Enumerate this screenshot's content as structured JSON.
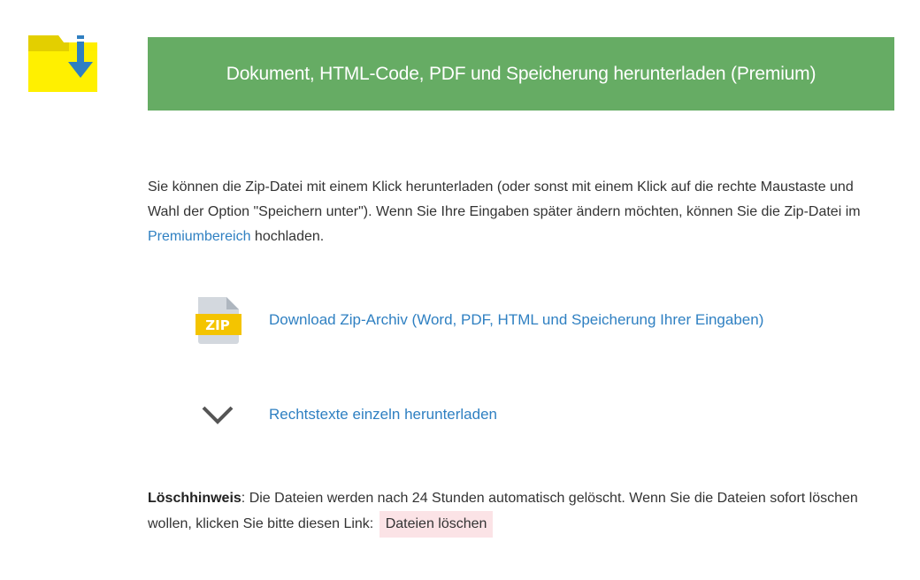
{
  "colors": {
    "banner_bg": "#66ac64",
    "link": "#2f80c2",
    "folder": "#ffee00",
    "download_arrow": "#2f7fc1",
    "delete_button_bg": "#fbe3e6"
  },
  "banner": {
    "title": "Dokument, HTML-Code, PDF und Speicherung herunterladen (Premium)"
  },
  "intro": {
    "text_before_link": "Sie können die Zip-Datei mit einem Klick herunterladen (oder sonst mit einem Klick auf die rechte Maustaste und Wahl der Option \"Speichern unter\"). Wenn Sie Ihre Eingaben später ändern möchten, können Sie die Zip-Datei im ",
    "link_label": "Premiumbereich",
    "text_after_link": " hochladen."
  },
  "downloads": {
    "zip_icon_label": "ZIP",
    "zip_link_label": "Download Zip-Archiv (Word, PDF, HTML und Speicherung Ihrer Eingaben)",
    "single_texts_label": "Rechtstexte einzeln herunterladen"
  },
  "notice": {
    "title": "Löschhinweis",
    "text": ": Die Dateien werden nach 24 Stunden automatisch gelöscht. Wenn Sie die Dateien sofort löschen wollen, klicken Sie bitte diesen Link: ",
    "delete_button_label": "Dateien löschen"
  },
  "icons": {
    "folder": "folder-download-icon",
    "zip": "zip-file-icon",
    "chevron": "chevron-down-icon"
  }
}
